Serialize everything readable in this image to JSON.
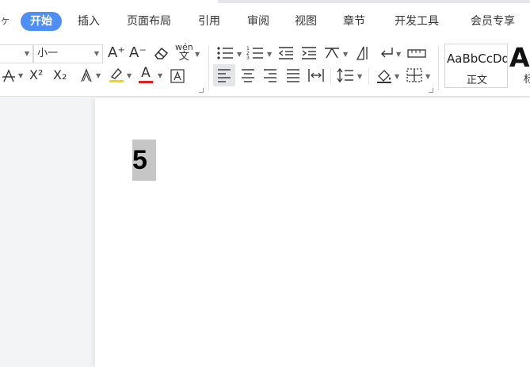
{
  "menu": {
    "left_arrow": "ヶ",
    "tabs": [
      {
        "label": "开始",
        "active": true
      },
      {
        "label": "插入"
      },
      {
        "label": "页面布局"
      },
      {
        "label": "引用"
      },
      {
        "label": "审阅"
      },
      {
        "label": "视图"
      },
      {
        "label": "章节"
      },
      {
        "label": "开发工具"
      },
      {
        "label": "会员专享"
      }
    ]
  },
  "ribbon": {
    "font_size": "小一",
    "icons": {
      "grow_font": "A⁺",
      "shrink_font": "A⁻",
      "phonetic": "wén",
      "superscript": "X²",
      "subscript": "X₂",
      "font_color": "A"
    },
    "styles": {
      "sample": "AaBbCcDd",
      "normal_label": "正文",
      "heading_sample": "Aa",
      "heading_label": "标"
    }
  },
  "document": {
    "text": "5"
  },
  "colors": {
    "active_tab": "#4e8ef7",
    "highlight": "#f5d800",
    "font_color_bar": "#e02020",
    "selection": "#c6c6c6"
  }
}
